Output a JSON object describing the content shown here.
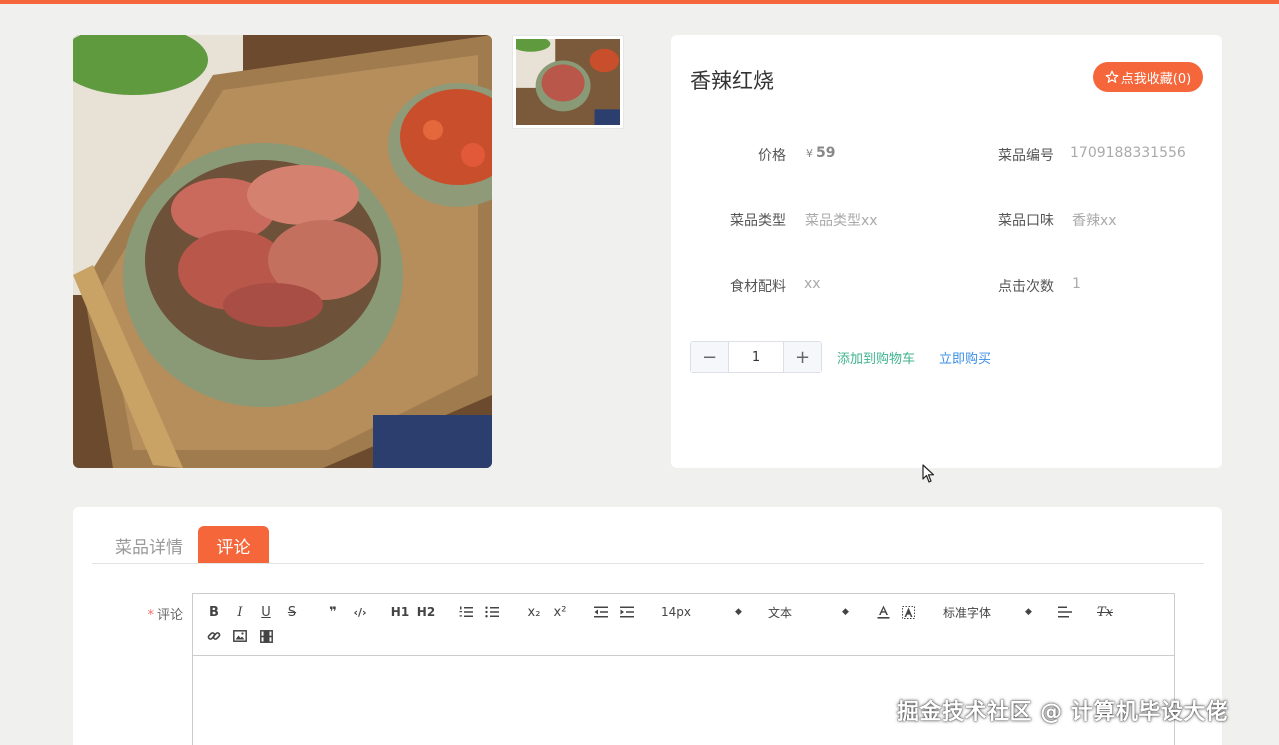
{
  "colors": {
    "accent": "#f5663b",
    "cart_link": "#3fb38e",
    "buy_link": "#3a8ee6"
  },
  "product": {
    "title": "香辣红烧",
    "favorite_label": "点我收藏(0)",
    "fields": {
      "price_label": "价格",
      "price_currency": "¥",
      "price_value": "59",
      "code_label": "菜品编号",
      "code_value": "1709188331556",
      "type_label": "菜品类型",
      "type_value": "菜品类型xx",
      "flavor_label": "菜品口味",
      "flavor_value": "香辣xx",
      "ingredients_label": "食材配料",
      "ingredients_value": "xx",
      "clicks_label": "点击次数",
      "clicks_value": "1"
    },
    "quantity": "1",
    "add_to_cart": "添加到购物车",
    "buy_now": "立即购买"
  },
  "tabs": {
    "detail": "菜品详情",
    "comment": "评论"
  },
  "comment_form": {
    "required_mark": "*",
    "label": "评论",
    "toolbar": {
      "bold": "B",
      "italic": "I",
      "underline": "U",
      "strike": "S",
      "quote": "❞",
      "code": "‹/›",
      "h1": "H1",
      "h2": "H2",
      "sub": "x₂",
      "sup": "x²",
      "size": "14px",
      "header": "文本",
      "font": "标准字体",
      "clean": "Tx"
    }
  },
  "icons": [
    "star-outline-icon",
    "minus-icon",
    "plus-icon",
    "ordered-list-icon",
    "bullet-list-icon",
    "indent-icon",
    "outdent-icon",
    "text-color-icon",
    "background-color-icon",
    "align-icon",
    "link-icon",
    "image-icon",
    "video-icon",
    "mouse-cursor-icon"
  ],
  "watermark": "掘金技术社区 @ 计算机毕设大佬"
}
